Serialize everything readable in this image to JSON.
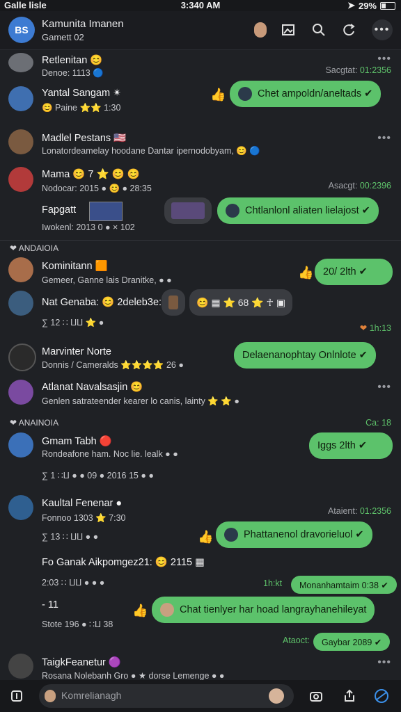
{
  "status": {
    "carrier": "Galle lisle",
    "time": "3:340 AM",
    "battery": "29%"
  },
  "header": {
    "title": "Kamunita Imanen",
    "subtitle": "Gamett 02",
    "avatar_text": "BS"
  },
  "messages": [
    {
      "name": "Retlenitan 😊",
      "meta": "Denoe: 1113 🔵",
      "ts_label": "Sacgtat:",
      "ts_time": "01:2356"
    },
    {
      "name": "Yantal Sangam ✴",
      "meta": "😊 Paine ⭐⭐ 1:30",
      "bubble": "Chet ampoldn/aneltads ✔"
    },
    {
      "name": "Madlel Pestans 🇺🇸",
      "meta": "Lonatordeamelay hoodane Dantar ipernodobyam, 😊 🔵"
    },
    {
      "name": "Mama 😊 7 ⭐ 😊 😊",
      "meta": "Nodocar: 2015 ● 😊 ● 28:35",
      "ts_label": "Asacgt:",
      "ts_time": "00:2396"
    },
    {
      "name": "Fapgatt",
      "meta": "Iwokenl: 2013 0 ● × 102",
      "bubble": "Chtlanlonl aliaten lielajost ✔"
    },
    {
      "name": "Kominitann 🟧",
      "meta": "Gemeer, Ganne lais Dranitke, ● ●",
      "bubble": "20/ 2lth ✔"
    },
    {
      "name": "Nat Genaba: 😊 2deleb3e:",
      "meta": "∑ 12 ∷ ⨿⨿ ⭐ ●",
      "pill": "😊 ▦ ⭐ 68 ⭐ ☥ ▣",
      "ts_time": "1h:13"
    },
    {
      "name": "Marvinter Norte",
      "meta": "Donnis / Cameralds ⭐⭐⭐⭐ 26 ●",
      "bubble": "Delaenanophtay Onlnlote ✔"
    },
    {
      "name": "Atlanat Navalsasjin 😊",
      "meta": "Genlen satrateender kearer lo canis, lainty ⭐ ⭐ ●"
    },
    {
      "name": "Gmam Tabh 🔴",
      "meta": "Rondeafone ham. Noc lie. lealk ● ●",
      "meta2": "∑ 1 ∷⨿ ● ● 09 ● 2016 15 ● ●",
      "bubble": "Iggs 2lth ✔",
      "ts_label": "",
      "ts_time": "Ca: 18"
    },
    {
      "name": "Kaultal Fenenar ●",
      "meta": "Fonnoo 1303 ⭐ 7:30",
      "meta2": "∑ 13 ∷ ⨿⨿ ● ●",
      "ts_label": "Ataient:",
      "ts_time": "01:2356",
      "bubble": "Phattanenol dravorieluol ✔"
    },
    {
      "name": "Fo Ganak Aikpomgez21: 😊 2115 ▦",
      "meta": "2:03 ∷ ⨿⨿ ● ● ●",
      "bubble": "Monanhamtaim 0:38 ✔"
    },
    {
      "name": "- 11",
      "meta": "Stote 196 ● ∷⨿ 38",
      "bubble": "Chat tienlyer har hoad langrayhanehileyat",
      "small_ts": "Ataoct:",
      "small_bubble": "Gaybar 2089 ✔"
    },
    {
      "name": "TaigkFeanetur 🟣",
      "meta": "Rosana Nolebanh Gro ● ★ dorse Lemenge ● ●"
    }
  ],
  "sections": [
    "❤ ANDAIOIA",
    "❤ ANAINOIA"
  ],
  "extra_labels": {
    "mid_ts": "Ca: 18",
    "small_green": "1b:13"
  },
  "composer": {
    "placeholder": "Komrelianagh"
  }
}
